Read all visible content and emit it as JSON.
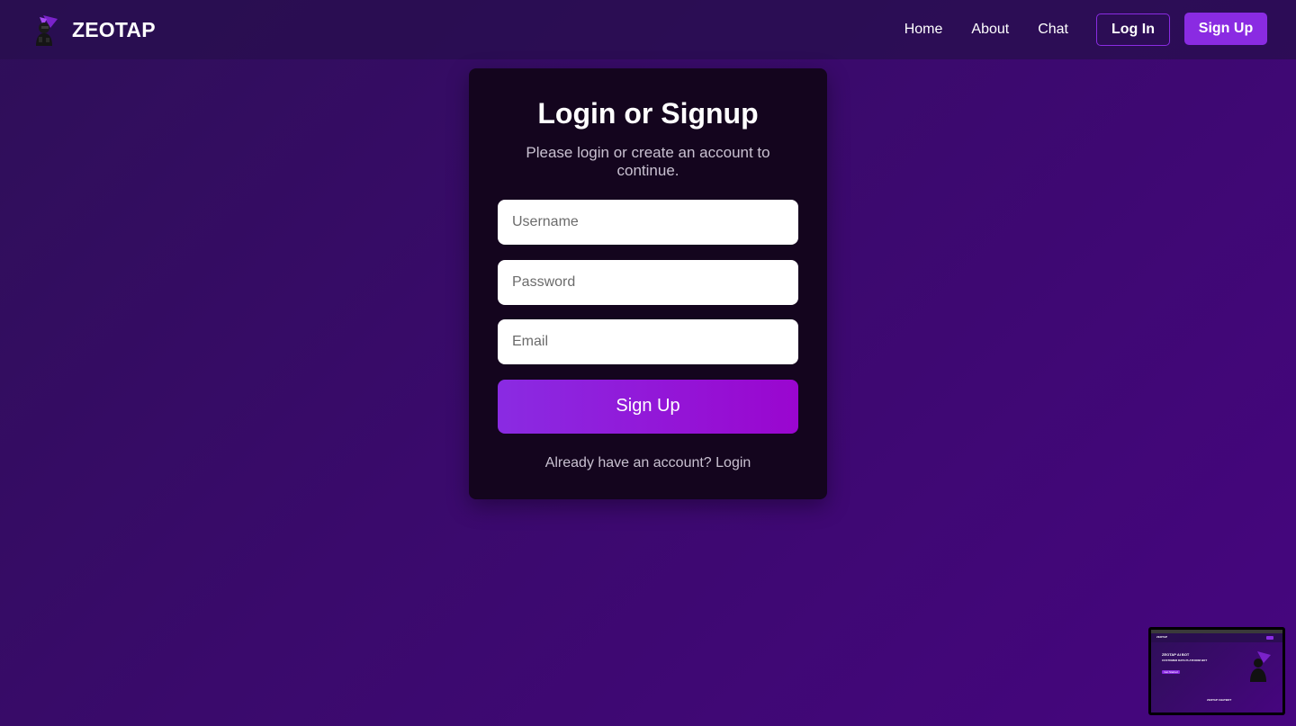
{
  "navbar": {
    "brand_name": "ZEOTAP",
    "links": [
      "Home",
      "About",
      "Chat"
    ],
    "login_label": "Log In",
    "signup_label": "Sign Up"
  },
  "auth": {
    "title": "Login or Signup",
    "subtitle": "Please login or create an account to continue.",
    "username_placeholder": "Username",
    "password_placeholder": "Password",
    "email_placeholder": "Email",
    "submit_label": "Sign Up",
    "switch_text": "Already have an account? Login"
  },
  "preview": {
    "brand": "ZEOTAP",
    "heading": "ZEOTAP AI BOT",
    "subheading": "CUSTOMER DATA PLATFORM BOT",
    "button": "Get Started",
    "footer": "ZEOTAP CHATBOT"
  },
  "icons": {
    "brand_logo": "robot-logo-icon"
  },
  "colors": {
    "accent": "#8a2be2",
    "background_start": "#2e0f58",
    "background_end": "#46057f",
    "card": "#14051e",
    "navbar": "#280e4e"
  }
}
